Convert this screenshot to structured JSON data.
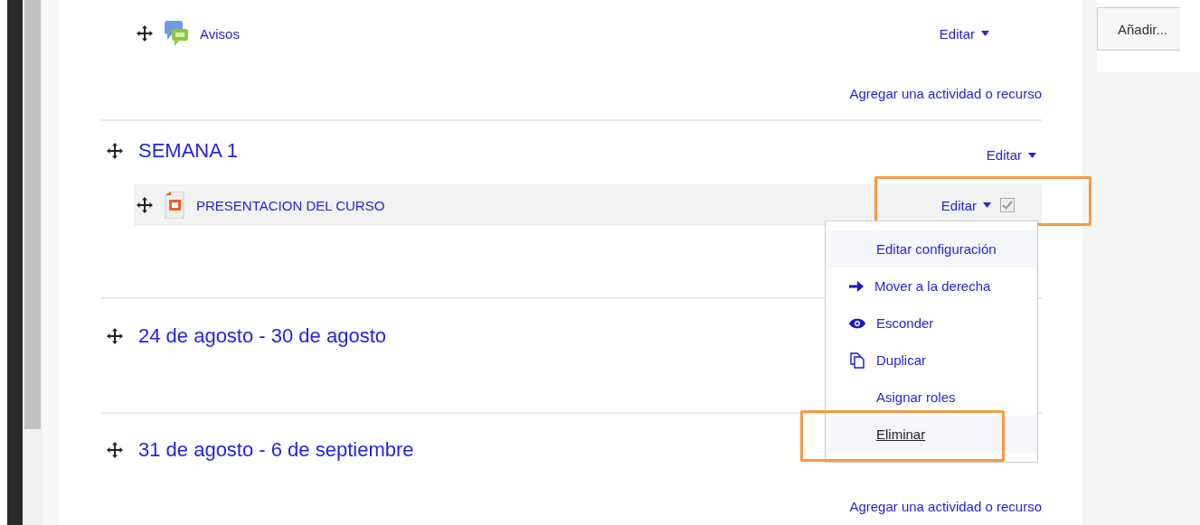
{
  "sidebar_block": {
    "button": "Añadir..."
  },
  "sections": [
    {
      "activities": [
        {
          "name": "Avisos",
          "kind": "forum",
          "edit": "Editar",
          "highlighted": false,
          "annotated": false
        }
      ],
      "add_link": "Agregar una actividad o recurso"
    },
    {
      "title": "SEMANA 1",
      "edit": "Editar",
      "activities": [
        {
          "name": "PRESENTACION DEL CURSO",
          "kind": "file",
          "edit": "Editar",
          "checkbox": {
            "checked": true,
            "disabled": true
          },
          "highlighted": true,
          "annotated": true
        }
      ]
    },
    {
      "title": "24 de agosto - 30 de agosto"
    },
    {
      "title": "31 de agosto - 6 de septiembre",
      "add_link": "Agregar una actividad o recurso"
    }
  ],
  "menu": {
    "items": [
      {
        "label": "Editar configuración",
        "kind": "plain",
        "hovered": true,
        "underlined": false,
        "annotated": false
      },
      {
        "label": "Mover a la derecha",
        "kind": "arrow",
        "hovered": false,
        "underlined": false,
        "annotated": false
      },
      {
        "label": "Esconder",
        "kind": "eye",
        "hovered": false,
        "underlined": false,
        "annotated": false
      },
      {
        "label": "Duplicar",
        "kind": "copy",
        "hovered": false,
        "underlined": false,
        "annotated": false
      },
      {
        "label": "Asignar roles",
        "kind": "plain",
        "hovered": false,
        "underlined": false,
        "annotated": false
      },
      {
        "label": "Eliminar",
        "kind": "plain",
        "hovered": true,
        "underlined": true,
        "annotated": true
      }
    ]
  }
}
